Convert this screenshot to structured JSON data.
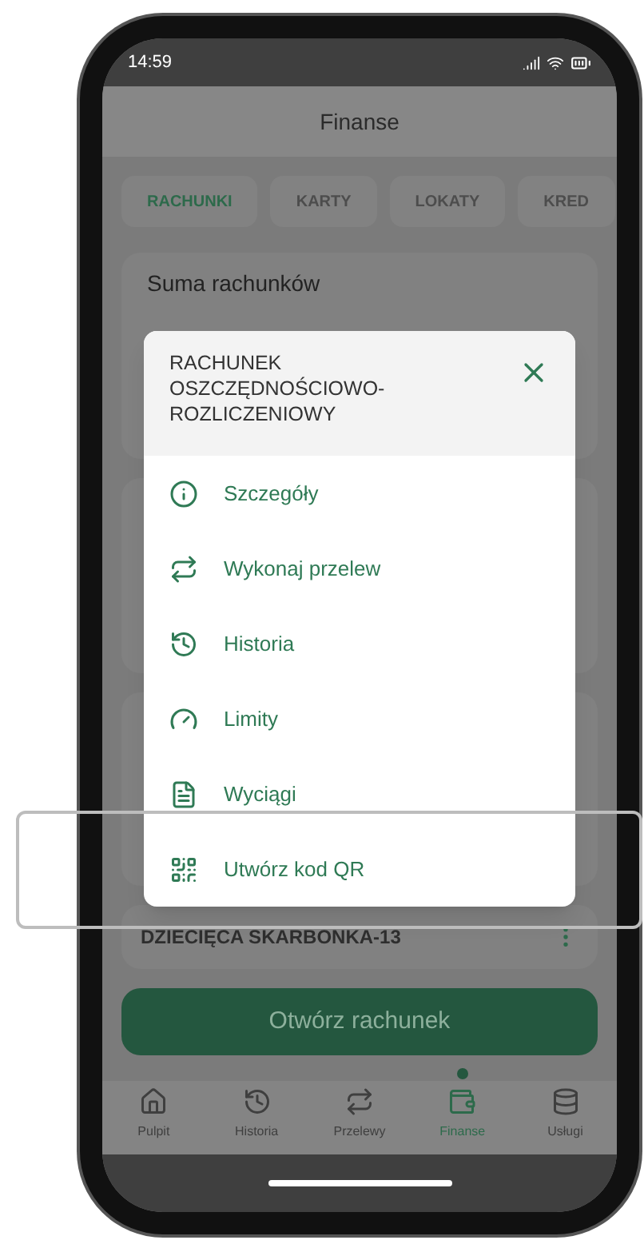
{
  "status_bar": {
    "time": "14:59"
  },
  "header": {
    "title": "Finanse"
  },
  "tabs": [
    {
      "label": "RACHUNKI",
      "selected": true
    },
    {
      "label": "KARTY",
      "selected": false
    },
    {
      "label": "LOKATY",
      "selected": false
    },
    {
      "label": "KRED",
      "selected": false
    }
  ],
  "summary_card": {
    "title": "Suma rachunków"
  },
  "account_row": {
    "name": "DZIECIĘCA SKARBONKA-13"
  },
  "menu": {
    "title": "RACHUNEK OSZCZĘDNOŚCIOWO-ROZLICZENIOWY",
    "items": [
      {
        "kind": "info",
        "label": "Szczegóły",
        "highlighted": false
      },
      {
        "kind": "transfer",
        "label": "Wykonaj przelew",
        "highlighted": false
      },
      {
        "kind": "history",
        "label": "Historia",
        "highlighted": false
      },
      {
        "kind": "limit",
        "label": "Limity",
        "highlighted": false
      },
      {
        "kind": "document",
        "label": "Wyciągi",
        "highlighted": false
      },
      {
        "kind": "qr",
        "label": "Utwórz kod QR",
        "highlighted": true
      }
    ]
  },
  "primary_button": {
    "label": "Otwórz rachunek"
  },
  "bottom_nav": [
    {
      "kind": "home",
      "label": "Pulpit",
      "selected": false
    },
    {
      "kind": "history",
      "label": "Historia",
      "selected": false
    },
    {
      "kind": "transfer",
      "label": "Przelewy",
      "selected": false
    },
    {
      "kind": "wallet",
      "label": "Finanse",
      "selected": true
    },
    {
      "kind": "database",
      "label": "Usługi",
      "selected": false
    }
  ]
}
